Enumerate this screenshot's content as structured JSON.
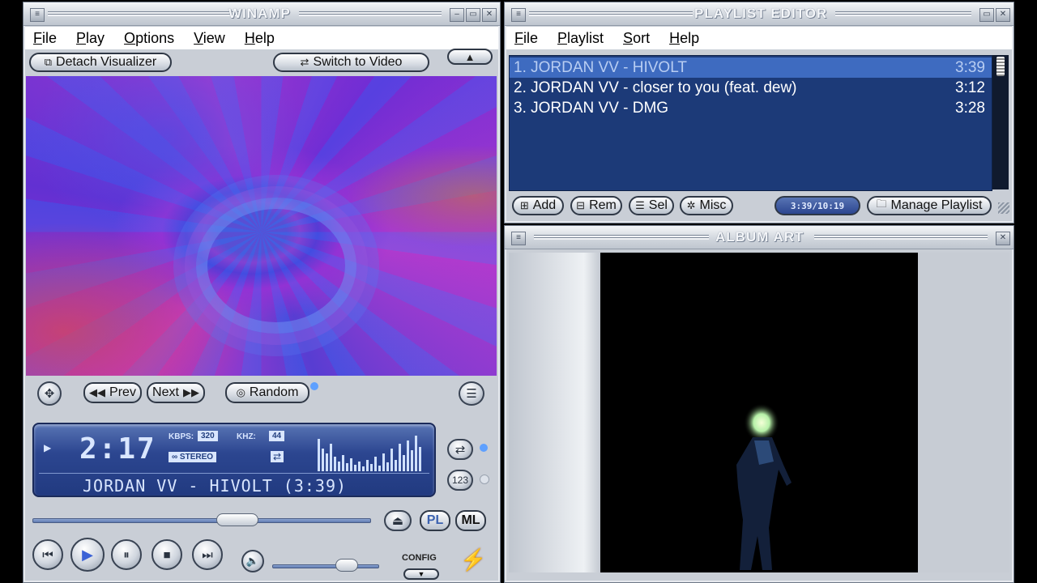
{
  "winamp": {
    "title": "WINAMP",
    "menu": [
      "File",
      "Play",
      "Options",
      "View",
      "Help"
    ],
    "detach_label": "Detach Visualizer",
    "switch_label": "Switch to Video",
    "prev_label": "Prev",
    "next_label": "Next",
    "random_label": "Random",
    "lcd": {
      "time": "2:17",
      "kbps_label": "KBPS:",
      "kbps": "320",
      "khz_label": "KHZ:",
      "khz": "44",
      "stereo": "STEREO",
      "scroll_text": "JORDAN VV - HIVOLT (3:39)"
    },
    "pl_label": "PL",
    "ml_label": "ML",
    "config_label": "CONFIG",
    "seek_position": 0.62,
    "volume": 0.75
  },
  "playlist": {
    "title": "PLAYLIST EDITOR",
    "menu": [
      "File",
      "Playlist",
      "Sort",
      "Help"
    ],
    "items": [
      {
        "title": "1. JORDAN VV - HIVOLT",
        "duration": "3:39",
        "selected": true
      },
      {
        "title": "2. JORDAN VV - closer to you (feat. dew)",
        "duration": "3:12",
        "selected": false
      },
      {
        "title": "3. JORDAN VV - DMG",
        "duration": "3:28",
        "selected": false
      }
    ],
    "buttons": {
      "add": "Add",
      "rem": "Rem",
      "sel": "Sel",
      "misc": "Misc",
      "time": "3:39/10:19",
      "manage": "Manage Playlist"
    }
  },
  "album_art": {
    "title": "ALBUM ART"
  },
  "colors": {
    "lcd_bg": "#2c4690",
    "playlist_bg": "#1c3a78",
    "playlist_selected": "#3e6bc0",
    "visualizer": "#7a2fd4"
  }
}
